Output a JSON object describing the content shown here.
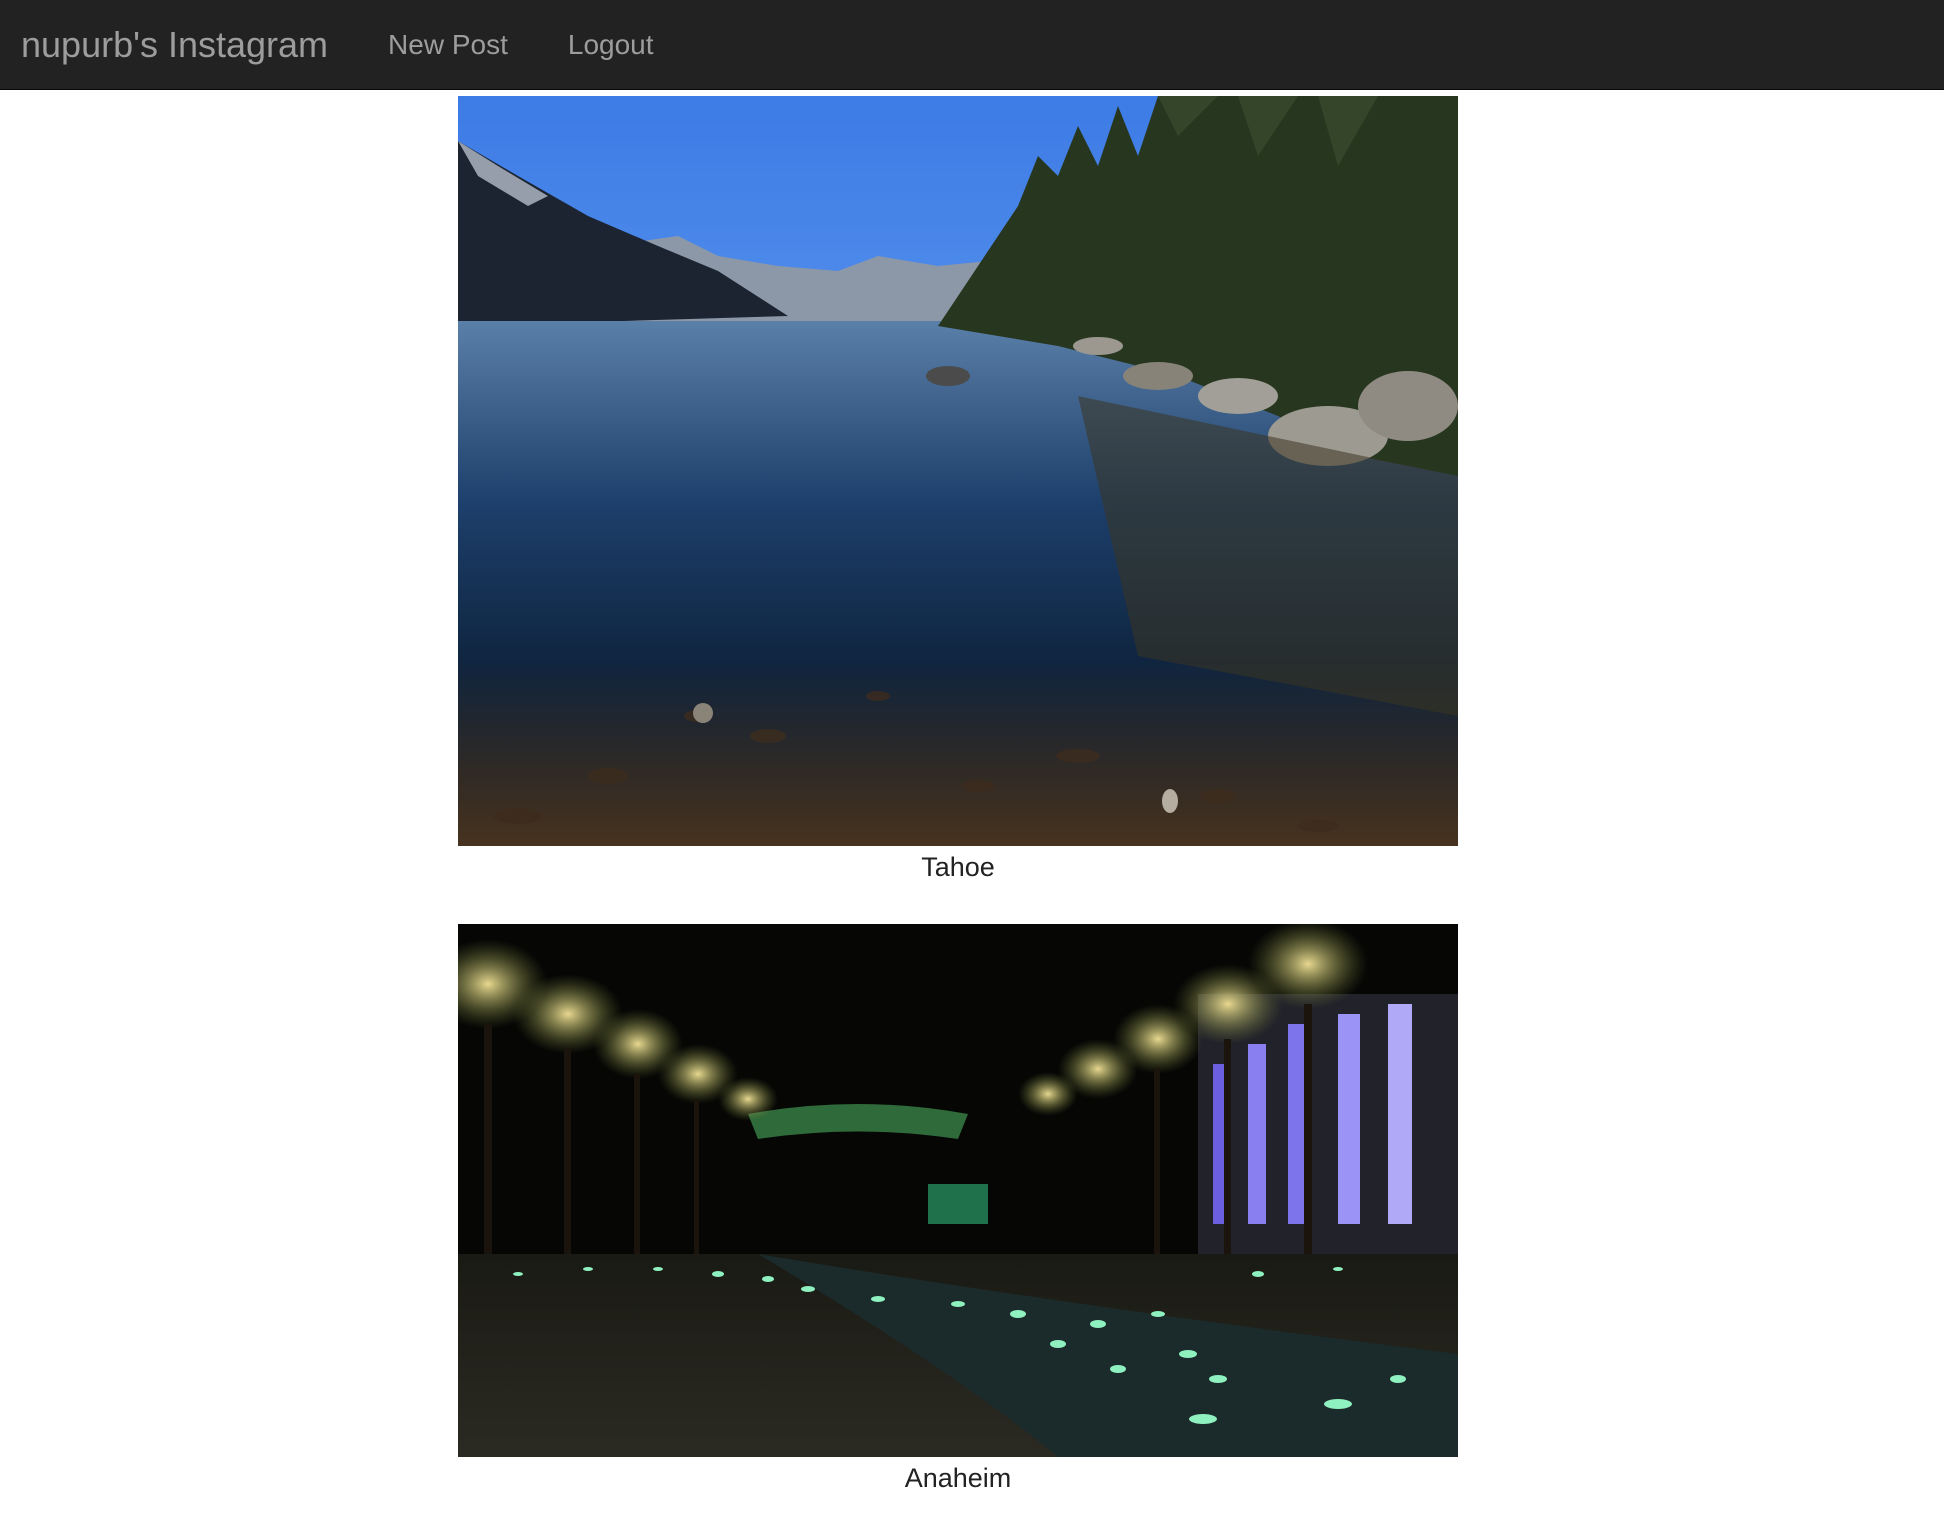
{
  "nav": {
    "brand": "nupurb's Instagram",
    "links": [
      {
        "label": "New Post"
      },
      {
        "label": "Logout"
      }
    ]
  },
  "posts": [
    {
      "caption": "Tahoe"
    },
    {
      "caption": "Anaheim"
    }
  ],
  "colors": {
    "navbar_bg": "#222222",
    "nav_text": "#9d9d9d"
  }
}
